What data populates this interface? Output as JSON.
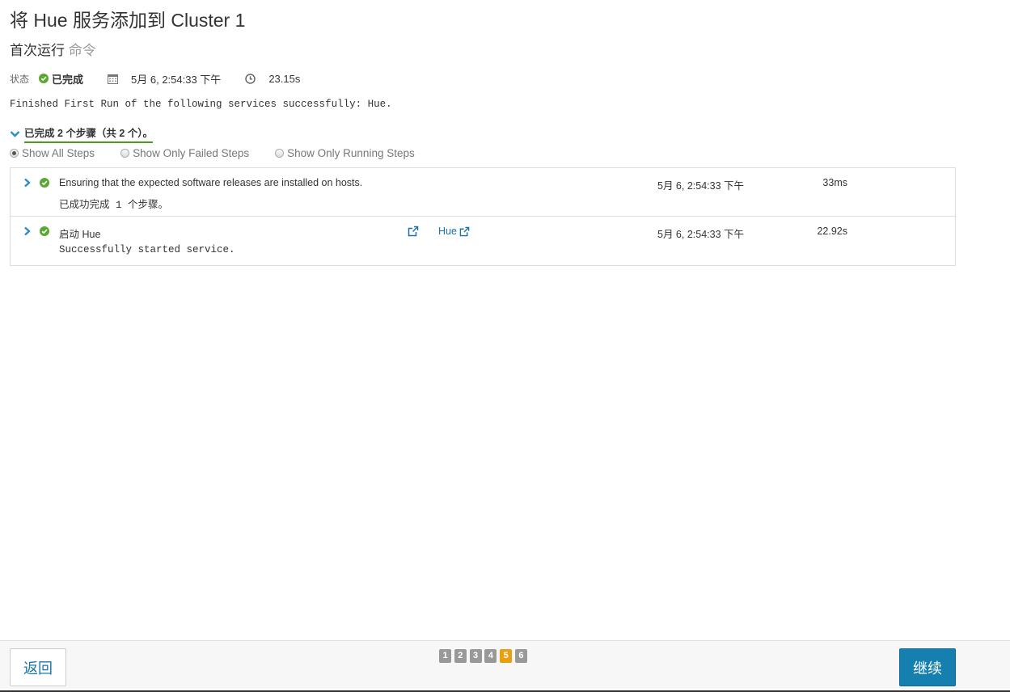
{
  "header": {
    "title": "将 Hue 服务添加到 Cluster 1",
    "subtitle_main": "首次运行",
    "subtitle_muted": "命令"
  },
  "status": {
    "label": "状态",
    "value": "已完成",
    "date": "5月 6, 2:54:33 下午",
    "duration": "23.15s",
    "accent": "#5aa832"
  },
  "message": "Finished First Run of the following services successfully: Hue.",
  "summary": "已完成 2 个步骤（共 2 个）。",
  "filters": {
    "selected": "Show All Steps",
    "options": [
      "Show All Steps",
      "Show Only Failed Steps",
      "Show Only Running Steps"
    ]
  },
  "steps": [
    {
      "name": "Ensuring that the expected software releases are installed on hosts.",
      "detail": "已成功完成 1 个步骤。",
      "time": "5月 6, 2:54:33 下午",
      "duration": "33ms"
    },
    {
      "name": "启动 Hue",
      "detail": "Successfully started service.",
      "service": "Hue",
      "time": "5月 6, 2:54:33 下午",
      "duration": "22.92s"
    }
  ],
  "footer": {
    "back_label": "返回",
    "continue_label": "继续",
    "pages": [
      "1",
      "2",
      "3",
      "4",
      "5",
      "6"
    ],
    "active_page": "5",
    "continue_color": "#1580b0"
  }
}
